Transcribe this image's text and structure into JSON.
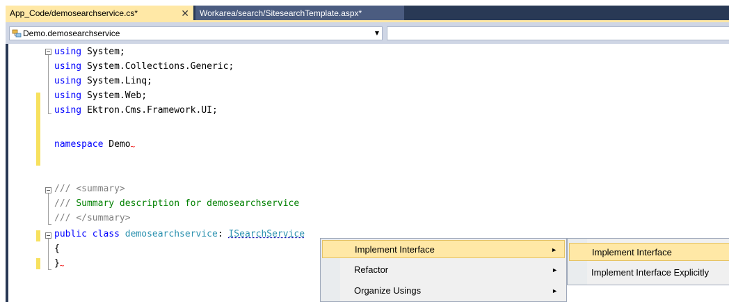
{
  "tabs": [
    {
      "label": "App_Code/demosearchservice.cs*",
      "close": "✕",
      "active": true
    },
    {
      "label": "Workarea/search/SitesearchTemplate.aspx*",
      "active": false
    }
  ],
  "navbar": {
    "type_selector": {
      "value": "Demo.demosearchservice",
      "icon": "class-icon",
      "arrow": "▼"
    },
    "member_selector": {
      "value": ""
    }
  },
  "code": {
    "line1": {
      "kw": "using",
      "rest": " System;"
    },
    "line2": {
      "kw": "using",
      "rest": " System.Collections.Generic;"
    },
    "line3": {
      "kw": "using",
      "rest": " System.Linq;"
    },
    "line4": {
      "kw": "using",
      "rest": " System.Web;"
    },
    "line5": {
      "kw": "using",
      "rest": " Ektron.Cms.Framework.UI;"
    },
    "line7": {
      "kw": "namespace",
      "rest": " Demo"
    },
    "line10": {
      "prefix": "/// ",
      "tag": "<summary>"
    },
    "line11": {
      "prefix": "/// ",
      "text": "Summary description for demosearchservice"
    },
    "line12": {
      "prefix": "/// ",
      "tag": "</summary>"
    },
    "line13": {
      "kw1": "public",
      "kw2": "class",
      "name": "demosearchservice",
      "sep": ": ",
      "base": "ISearchService"
    },
    "line14": {
      "text": "{"
    },
    "line15": {
      "text": "}"
    }
  },
  "context_menu": {
    "items": [
      {
        "label": "Implement Interface",
        "submenu": "►"
      },
      {
        "label": "Refactor",
        "submenu": "►"
      },
      {
        "label": "Organize Usings",
        "submenu": "►"
      }
    ]
  },
  "submenu": {
    "items": [
      {
        "label": "Implement Interface"
      },
      {
        "label": "Implement Interface Explicitly"
      }
    ]
  },
  "colors": {
    "keyword": "#0000FF",
    "type": "#2B91AF",
    "comment": "#008000",
    "tab_active": "#FFE8A6",
    "chrome": "#293955",
    "change_marker": "#F7E15E"
  }
}
